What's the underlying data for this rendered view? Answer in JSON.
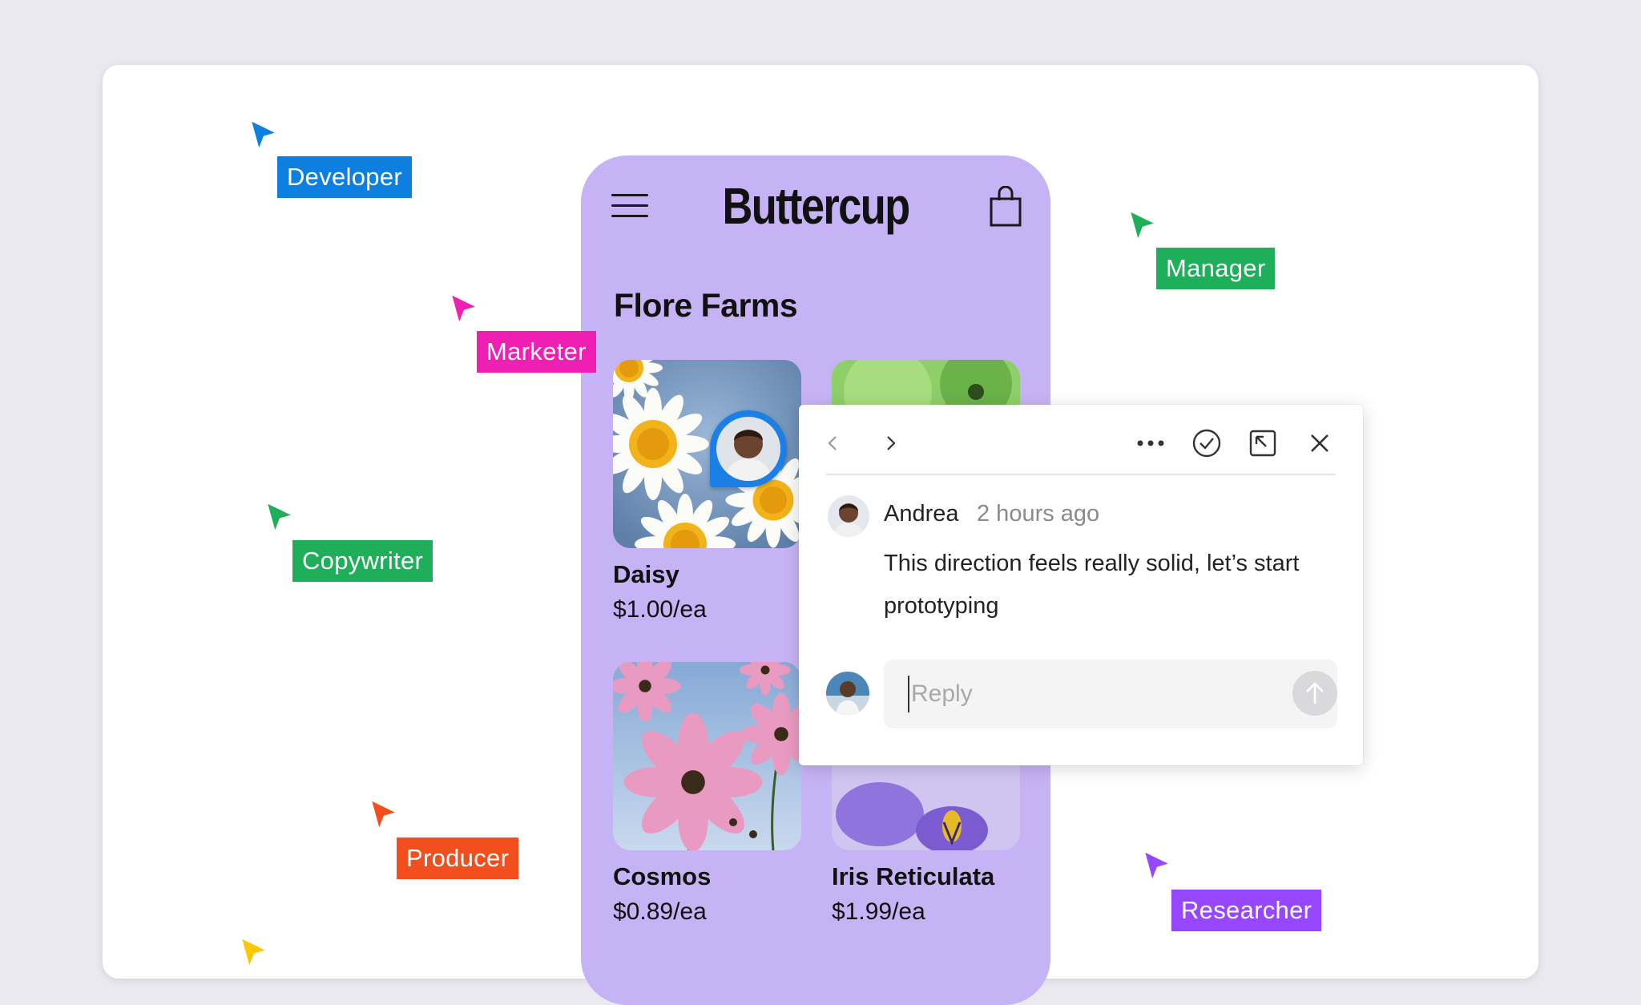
{
  "colors": {
    "background": "#e9e9ef",
    "phone": "#c6b3f5",
    "developer": "#0d7fe0",
    "manager": "#1fae5a",
    "marketer": "#f01fb4",
    "copywriter": "#1fae5a",
    "producer": "#f24e1e",
    "researcher": "#9747ff",
    "partial": "#ffc700"
  },
  "collaborators": [
    {
      "name": "Developer"
    },
    {
      "name": "Manager"
    },
    {
      "name": "Marketer"
    },
    {
      "name": "Copywriter"
    },
    {
      "name": "Producer"
    },
    {
      "name": "Researcher"
    }
  ],
  "app": {
    "brand": "Buttercup",
    "menu_icon": "hamburger-menu-icon",
    "cart_icon": "shopping-bag-icon",
    "store_title": "Flore Farms",
    "products": [
      {
        "name": "Daisy",
        "price": "$1.00/ea"
      },
      {
        "name": "Cosmos",
        "price": "$0.89/ea"
      },
      {
        "name": "Iris Reticulata",
        "price": "$1.99/ea"
      }
    ]
  },
  "comment": {
    "toolbar_icons": [
      "chevron-left-icon",
      "chevron-right-icon",
      "more-icon",
      "resolve-check-icon",
      "expand-icon",
      "close-icon"
    ],
    "author": "Andrea",
    "time": "2 hours ago",
    "text": "This direction feels really solid, let’s start prototyping",
    "reply_placeholder": "Reply"
  }
}
